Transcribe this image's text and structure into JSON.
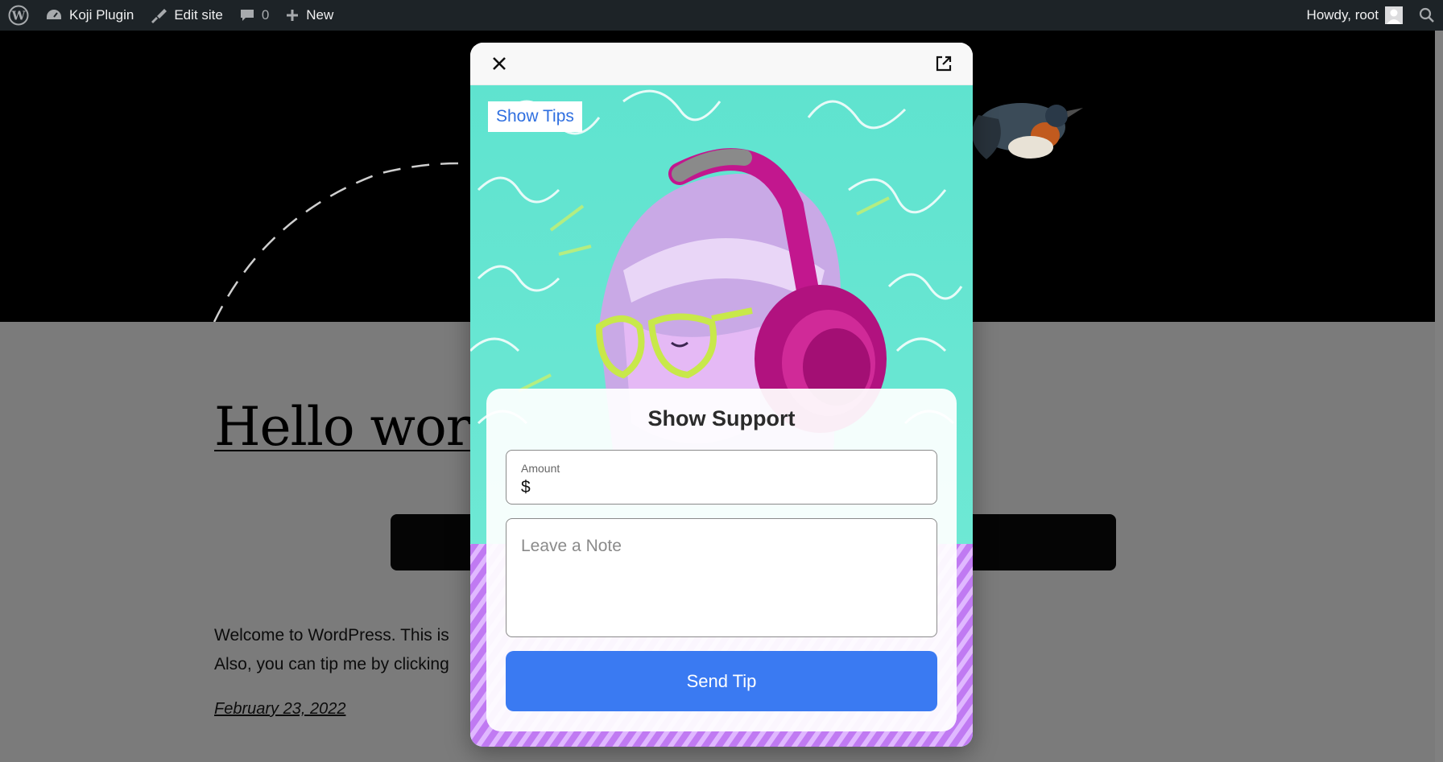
{
  "adminbar": {
    "site_name": "Koji Plugin",
    "edit_site": "Edit site",
    "comments_count": "0",
    "new_label": "New",
    "howdy": "Howdy, root"
  },
  "post": {
    "title": "Hello world!",
    "line1": "Welcome to WordPress. This is",
    "line2": "Also, you can tip me by clicking",
    "date": "February 23, 2022"
  },
  "modal": {
    "show_tips": "Show Tips",
    "card_title": "Show Support",
    "amount_label": "Amount",
    "amount_prefix": "$",
    "amount_value": "",
    "note_placeholder": "Leave a Note",
    "send_button": "Send Tip"
  },
  "colors": {
    "admin_bar": "#1d2327",
    "primary_button": "#3a7af2",
    "show_tips_text": "#2f6fe0",
    "artwork_teal": "#6ee6d2",
    "artwork_pink": "#c2178e",
    "artwork_purple": "#b86cf0"
  },
  "icons": {
    "wordpress": "wordpress-logo-icon",
    "dashboard": "dashboard-icon",
    "edit": "brush-icon",
    "comments": "comment-bubble-icon",
    "new": "plus-icon",
    "avatar": "user-avatar-icon",
    "search": "search-icon",
    "close": "close-icon",
    "open_external": "external-link-icon"
  }
}
